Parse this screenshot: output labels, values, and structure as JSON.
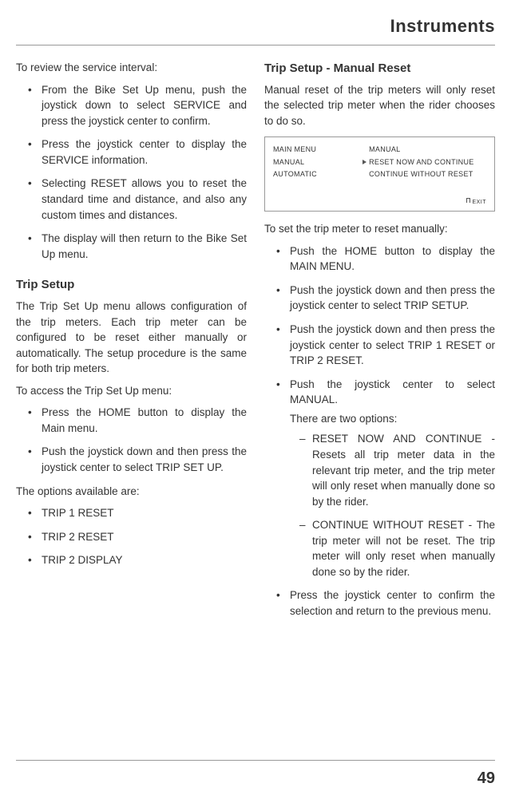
{
  "header": {
    "title": "Instruments"
  },
  "left": {
    "intro": "To review the service interval:",
    "service_bullets": [
      "From the Bike Set Up menu, push the joystick down to select SERVICE and press the joystick center to confirm.",
      "Press the joystick center to display the SERVICE information.",
      "Selecting RESET allows you to reset the standard time and distance, and also any custom times and distances.",
      "The display will then return to the Bike Set Up menu."
    ],
    "trip_setup_heading": "Trip Setup",
    "trip_setup_para": "The Trip Set Up menu allows configuration of the trip meters. Each trip meter can be configured to be reset either manually or automatically. The setup procedure is the same for both trip meters.",
    "access_intro": "To access the Trip Set Up menu:",
    "access_bullets": [
      "Press the HOME button to display the Main menu.",
      "Push the joystick down and then press the joystick center to select TRIP SET UP."
    ],
    "options_intro": "The options available are:",
    "option_bullets": [
      "TRIP 1 RESET",
      "TRIP 2 RESET",
      "TRIP 2 DISPLAY"
    ]
  },
  "right": {
    "heading": "Trip Setup - Manual Reset",
    "intro": "Manual reset of the trip meters will only reset the selected trip meter when the rider chooses to do so.",
    "screen": {
      "left_rows": [
        "MAIN MENU",
        "MANUAL",
        "AUTOMATIC"
      ],
      "right_rows": [
        "MANUAL",
        "RESET NOW AND CONTINUE",
        "CONTINUE WITHOUT RESET"
      ],
      "exit": "EXIT"
    },
    "set_intro": "To set the trip meter to reset manually:",
    "set_bullets": [
      "Push the HOME button to display the MAIN MENU.",
      "Push the joystick down and then press the joystick center to select TRIP SETUP.",
      "Push the joystick down and then press the joystick center to select TRIP 1 RESET or TRIP 2 RESET.",
      "Push the joystick center to select MANUAL."
    ],
    "two_options_intro": "There are two options:",
    "two_options": [
      "RESET NOW AND CONTINUE - Resets all trip meter data in the relevant trip meter, and the trip meter will only reset when manually done so by the rider.",
      "CONTINUE WITHOUT RESET - The trip meter will not be reset. The trip meter will only reset when manually done so by the rider."
    ],
    "final_bullet": "Press the joystick center to confirm the selection and return to the previous menu."
  },
  "page_number": "49"
}
